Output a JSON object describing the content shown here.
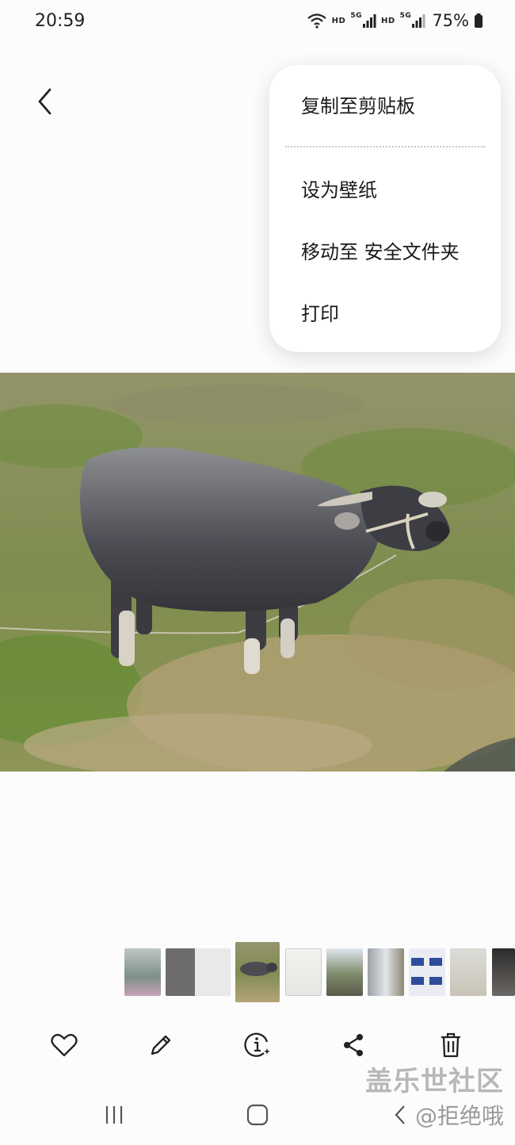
{
  "status_bar": {
    "time": "20:59",
    "hd1": "HD",
    "hd2": "HD",
    "net1": "5G",
    "net2": "5G",
    "battery": "75%"
  },
  "menu": {
    "items": [
      "复制至剪贴板",
      "设为壁纸",
      "移动至 安全文件夹",
      "打印"
    ]
  },
  "toolbar": {
    "icons": [
      "heart-icon",
      "pencil-icon",
      "info-icon",
      "share-icon",
      "trash-icon"
    ]
  },
  "nav": {
    "icons": [
      "recents-icon",
      "home-icon",
      "back-icon"
    ]
  },
  "watermark": {
    "site": "盖乐世社区",
    "user": "@拒绝哦"
  }
}
